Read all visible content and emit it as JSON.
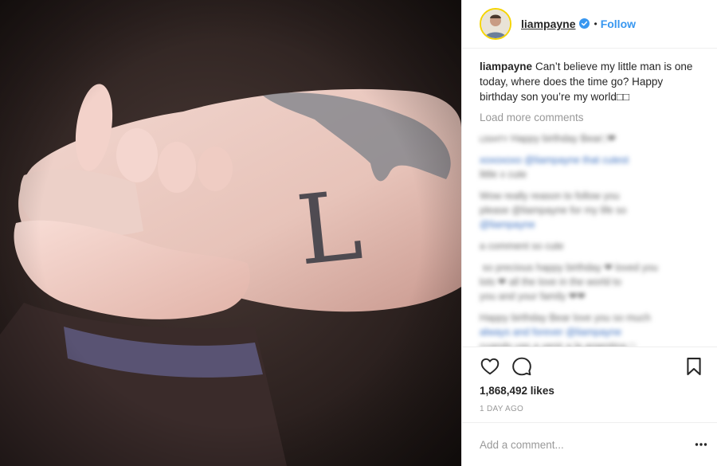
{
  "post": {
    "username": "liampayne",
    "follow_label": "Follow",
    "separator": "•",
    "caption_text": "Can’t believe my little man is one today, where does the time go? Happy birthday son you’re my world□□",
    "load_more_label": "Load more comments",
    "likes": "1,868,492 likes",
    "timestamp": "1 DAY AGO",
    "comment_placeholder": "Add a comment...",
    "photo_tattoo_letter": "L"
  },
  "blurred_comments": [
    {
      "lines": [
        "ʟɪɢʜᴛʏ Happy birthday Bear□❤"
      ],
      "blue": []
    },
    {
      "lines": [
        "xoxoxoxo @liampayne that cutest",
        "little x cute"
      ],
      "blue": []
    },
    {
      "lines": [
        "Wow really reason to follow you",
        "please @liampayne for my life so",
        "@liampayne"
      ],
      "blue": []
    },
    {
      "lines": [
        "a comment so cute"
      ],
      "blue": []
    },
    {
      "lines": [
        "⁣ so precious happy birthday ❤ loved you",
        "lots ❤ all the love in the world to",
        "you and your family ❤❤"
      ],
      "blue": []
    },
    {
      "lines": [
        "Happy birthday Bear love you so much",
        "always and forever @liampayne",
        "cuando vas a venir a la argentina □"
      ],
      "blue": []
    }
  ],
  "icons": {
    "verified": "verified-badge-icon",
    "like": "heart-icon",
    "comment": "comment-bubble-icon",
    "save": "bookmark-icon",
    "more": "more-options-icon"
  },
  "colors": {
    "link_blue": "#3897f0",
    "verified_blue": "#3897f0",
    "avatar_ring": "#f5d400",
    "muted": "#999999"
  }
}
